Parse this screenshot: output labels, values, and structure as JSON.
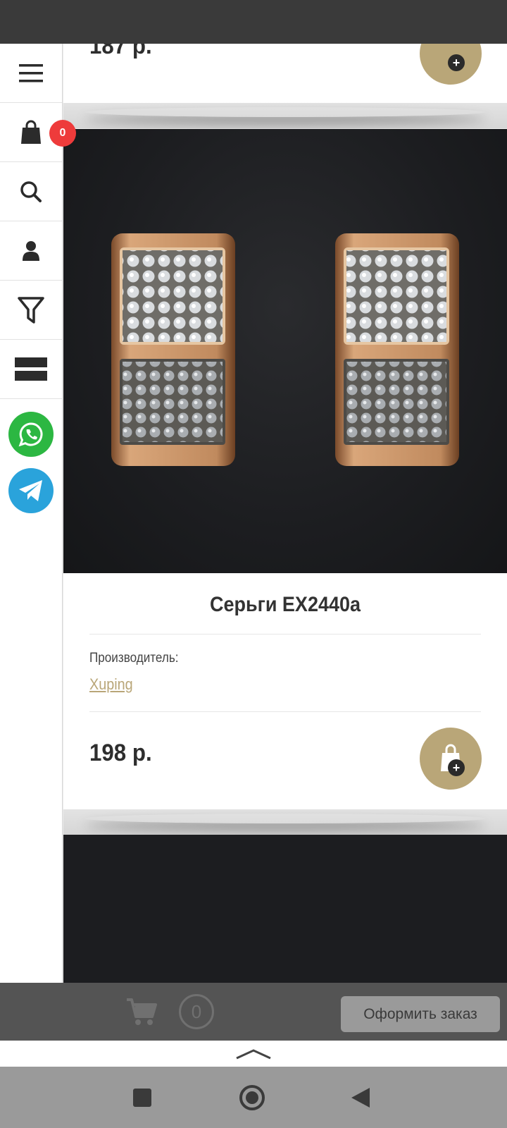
{
  "sidebar": {
    "cart_badge": "0"
  },
  "previous_product": {
    "price": "187 р."
  },
  "product": {
    "title": "Серьги EX2440a",
    "manufacturer_label": "Производитель:",
    "manufacturer": "Xuping",
    "price": "198 р."
  },
  "cart_bar": {
    "count": "0",
    "order_button": "Оформить заказ"
  },
  "icons": {
    "menu": "menu-icon",
    "cart": "shopping-bag-icon",
    "search": "search-icon",
    "account": "user-icon",
    "filter": "filter-icon",
    "view": "list-view-icon",
    "whatsapp": "whatsapp-icon",
    "telegram": "telegram-icon",
    "add_to_cart": "add-to-cart-icon",
    "scroll_up": "chevron-up-icon"
  },
  "colors": {
    "accent_gold": "#b9a678",
    "badge_red": "#ee3b3b",
    "whatsapp_green": "#2cb742",
    "telegram_blue": "#2aa3db"
  }
}
